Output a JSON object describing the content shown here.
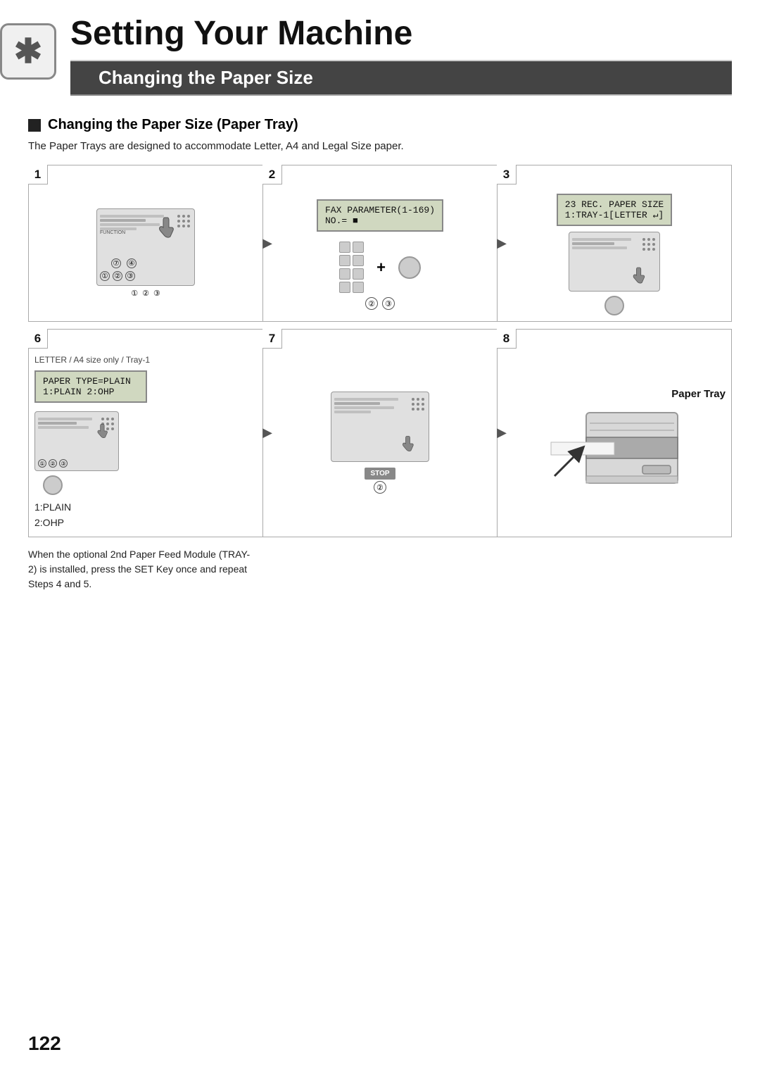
{
  "header": {
    "title": "Setting Your Machine",
    "icon_symbol": "✱",
    "section_title": "Changing the Paper Size"
  },
  "sub_section": {
    "heading": "Changing the Paper Size (Paper Tray)"
  },
  "intro": {
    "text": "The Paper Trays are designed to accommodate Letter, A4 and Legal Size paper."
  },
  "steps_row1": [
    {
      "number": "1",
      "type": "machine_with_hand"
    },
    {
      "number": "2",
      "type": "lcd_keypad",
      "lcd_line1": "FAX PARAMETER(1-169)",
      "lcd_line2": "NO.= ■"
    },
    {
      "number": "3",
      "type": "lcd_machine",
      "lcd_line1": "23 REC. PAPER SIZE",
      "lcd_line2": "1:TRAY-1[LETTER ↵]"
    }
  ],
  "steps_row2": [
    {
      "number": "6",
      "type": "lcd_keypad2",
      "label": "LETTER / A4 size only / Tray-1",
      "lcd_line1": "PAPER TYPE=PLAIN",
      "lcd_line2": "1:PLAIN 2:OHP",
      "sublabel1": "1:PLAIN",
      "sublabel2": "2:OHP"
    },
    {
      "number": "7",
      "type": "machine_stop"
    },
    {
      "number": "8",
      "type": "paper_tray",
      "label": "Paper Tray"
    }
  ],
  "bottom_note": {
    "text": "When the optional 2nd Paper Feed Module (TRAY-2) is installed, press the SET Key once and repeat Steps 4 and 5."
  },
  "page_number": "122",
  "labels": {
    "circled": [
      "①",
      "②",
      "③",
      "④",
      "⑦",
      "②",
      "③",
      "①",
      "②",
      "③"
    ]
  }
}
